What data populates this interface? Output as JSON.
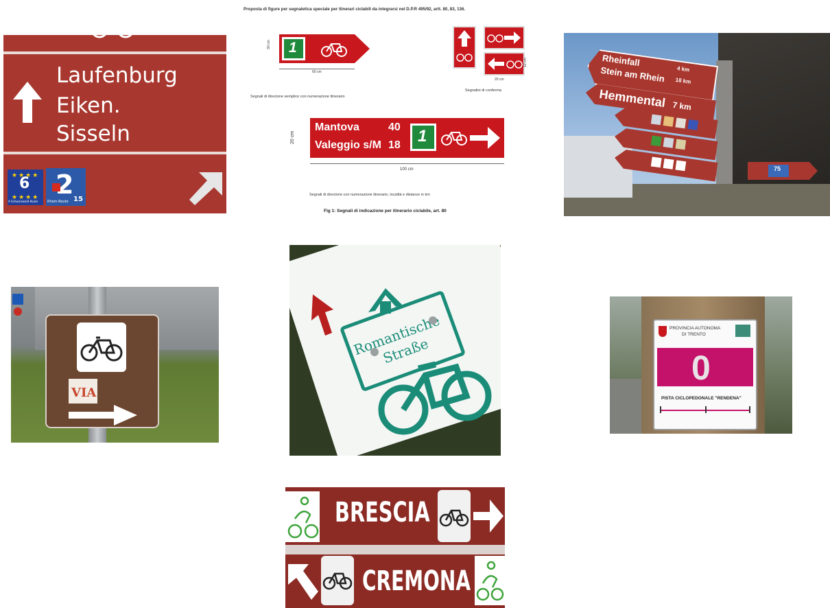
{
  "colors": {
    "page_background": "#ffffff",
    "swiss_red": "#a8382f",
    "italian_red": "#c8171d",
    "ticino_brown": "#7b3a26",
    "via_brown": "#6b4630",
    "romantic_teal": "#1a8c78",
    "trento_magenta": "#c4126a",
    "lombardia_brown": "#8c2a24",
    "green_route": "#1f8a3c"
  },
  "photo1": {
    "places": [
      "Laufenburg",
      "Eiken.",
      "Sisseln"
    ],
    "eu_route_number": "6",
    "eu_route_caption": "A Schwarzwald-Route",
    "ch_route_number": "2",
    "ch_route_caption": "Rhein-Route",
    "ch_route_subnumber": "15",
    "icons": [
      "bicycle-icon",
      "arrow-up-icon",
      "arrow-up-right-icon"
    ]
  },
  "photo2": {
    "header": "Proposta di figure per segnaletica speciale per itinerari ciclabili da integrarsi nel D.P.R 495/92, artt. 80, 83, 136.",
    "small_sign_number": "1",
    "dim_height_small": "30 cm",
    "dim_width_small": "60 cm",
    "caption_small": "Segnali di direzione semplice con numerazione itinerario",
    "caption_confirm": "Segnalini di conferma",
    "dim_confirm_width": "20 cm",
    "dim_confirm_height": "12 cm",
    "big_sign_rows": [
      {
        "place": "Mantova",
        "km": "40"
      },
      {
        "place": "Valeggio s/M",
        "km": "18"
      }
    ],
    "big_sign_number": "1",
    "dim_big_height": "20 cm",
    "dim_big_width": "100 cm",
    "caption_big": "Segnali di direzione con numerazione itinerario, località e distanze in km",
    "figure_caption": "Fig 1: Segnali di indicazione per itinerario ciclabile, art. 80"
  },
  "photo3": {
    "sign1_lines": [
      "Rheinfall",
      "Stein am Rhein"
    ],
    "sign1_km": [
      "4 km",
      "18 km"
    ],
    "sign2_place": "Hemmental",
    "sign2_km": "7 km",
    "small_sign_number": "75"
  },
  "photo4": {
    "via_text": "VIA"
  },
  "photo5": {
    "route_name_line1": "Romantische",
    "route_name_line2": "Straße"
  },
  "photo6": {
    "authority_line1": "PROVINCIA AUTONOMA",
    "authority_line2": "DI TRENTO",
    "route_number": "0",
    "route_name": "PISTA CICLOPEDONALE \"RENDENA\""
  },
  "photo7": {
    "top_place": "BRESCIA",
    "bottom_place": "CREMONA"
  }
}
